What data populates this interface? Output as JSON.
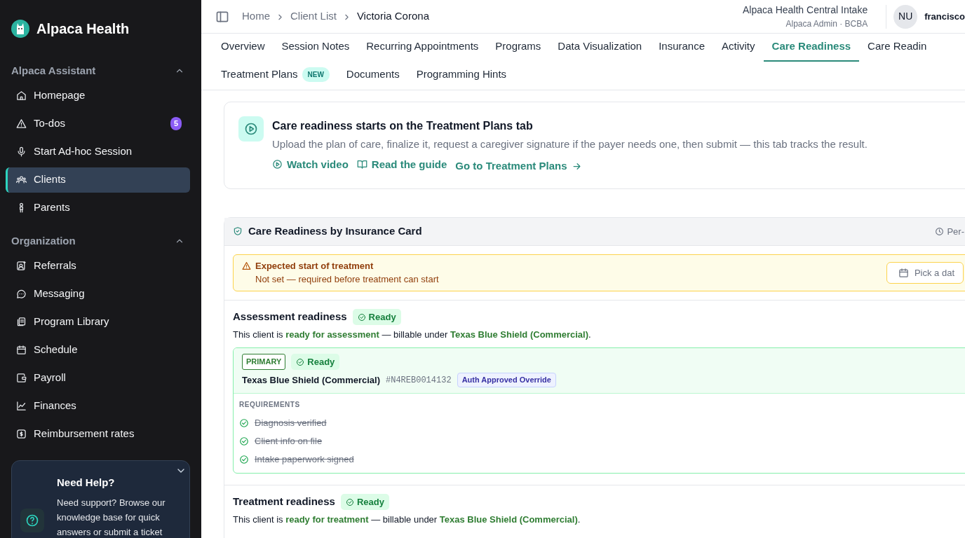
{
  "brand": {
    "name": "Alpaca Health"
  },
  "sidebar": {
    "sections": [
      {
        "title": "Alpaca Assistant",
        "expanded": true,
        "items": [
          {
            "label": "Homepage",
            "selected": false
          },
          {
            "label": "To-dos",
            "badge": "5",
            "selected": false
          },
          {
            "label": "Start Ad-hoc Session",
            "selected": false
          },
          {
            "label": "Clients",
            "selected": true
          },
          {
            "label": "Parents",
            "selected": false
          }
        ]
      },
      {
        "title": "Organization",
        "expanded": true,
        "items": [
          {
            "label": "Referrals",
            "selected": false
          },
          {
            "label": "Messaging",
            "selected": false
          },
          {
            "label": "Program Library",
            "selected": false
          },
          {
            "label": "Schedule",
            "selected": false
          },
          {
            "label": "Payroll",
            "selected": false
          },
          {
            "label": "Finances",
            "selected": false
          },
          {
            "label": "Reimbursement rates",
            "selected": false
          }
        ]
      }
    ]
  },
  "help_card": {
    "title": "Need Help?",
    "text": "Need support? Browse our knowledge base for quick answers or submit a ticket"
  },
  "breadcrumbs": [
    {
      "label": "Home",
      "current": false
    },
    {
      "label": "Client List",
      "current": false
    },
    {
      "label": "Victoria Corona",
      "current": true
    }
  ],
  "org": {
    "name": "Alpaca Health Central Intake",
    "role": "Alpaca Admin · BCBA"
  },
  "user": {
    "initials": "NU",
    "name": "francisco"
  },
  "tab_rows": [
    [
      {
        "label": "Overview",
        "selected": false
      },
      {
        "label": "Session Notes",
        "selected": false
      },
      {
        "label": "Recurring Appointments",
        "selected": false
      },
      {
        "label": "Programs",
        "selected": false
      },
      {
        "label": "Data Visualization",
        "selected": false
      },
      {
        "label": "Insurance",
        "selected": false
      },
      {
        "label": "Activity",
        "selected": false
      },
      {
        "label": "Care Readiness",
        "selected": true
      },
      {
        "label": "Care Readin",
        "selected": false
      }
    ],
    [
      {
        "label": "Treatment Plans",
        "badge": "NEW",
        "selected": false
      },
      {
        "label": "Documents",
        "selected": false
      },
      {
        "label": "Programming Hints",
        "selected": false
      }
    ]
  ],
  "banner": {
    "title": "Care readiness starts on the Treatment Plans tab",
    "text": "Upload the plan of care, finalize it, request a caregiver signature if the payer needs one, then submit — this tab tracks the result.",
    "links": [
      {
        "label": "Watch video"
      },
      {
        "label": "Read the guide"
      },
      {
        "label": "Go to Treatment Plans"
      }
    ]
  },
  "readiness_panel": {
    "title": "Care Readiness by Insurance Card",
    "meta": "Per-",
    "alert": {
      "title": "Expected start of treatment",
      "text": "Not set — required before treatment can start",
      "button": "Pick a dat"
    },
    "sections": [
      {
        "title": "Assessment readiness",
        "status": "Ready",
        "summary": "This client is **ready for assessment** — billable under **Texas Blue Shield (Commercial)**.",
        "cards": [
          {
            "rank": "PRIMARY",
            "status": "Ready",
            "payer": "Texas Blue Shield (Commercial)",
            "member_id": "#N4REB0014132",
            "tag": "Auth Approved Override",
            "requirements_label": "REQUIREMENTS",
            "requirements": [
              {
                "label": "Diagnosis verified",
                "done": true
              },
              {
                "label": "Client info on file",
                "done": true
              },
              {
                "label": "Intake paperwork signed",
                "done": true
              }
            ]
          }
        ]
      },
      {
        "title": "Treatment readiness",
        "status": "Ready",
        "summary": "This client is **ready for treatment** — billable under **Texas Blue Shield (Commercial)**."
      }
    ]
  }
}
